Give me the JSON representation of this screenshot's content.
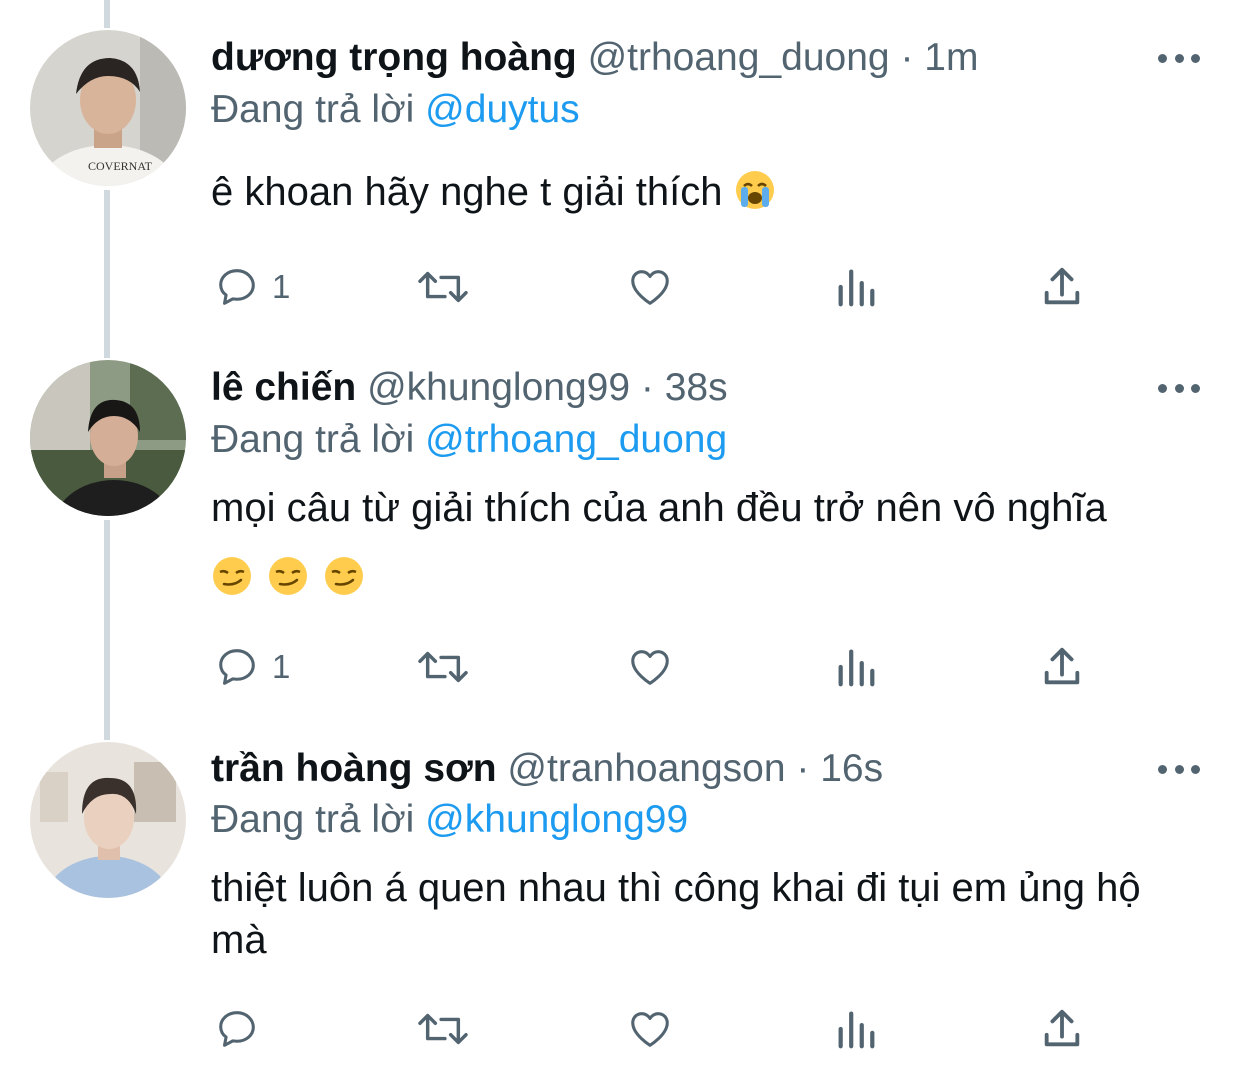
{
  "colors": {
    "mention": "#1d9bf0",
    "secondary_text": "#536471",
    "primary_text": "#0f1419",
    "thread_line": "#cfd9de"
  },
  "icons": {
    "reply": "speech-bubble-icon",
    "retweet": "retweet-icon",
    "like": "heart-icon",
    "views": "bar-chart-icon",
    "share": "share-upload-icon",
    "more": "more-dots-icon"
  },
  "tweets": [
    {
      "name": "dương trọng hoàng",
      "handle": "@trhoang_duong",
      "separator": "·",
      "time": "1m",
      "replying_prefix": "Đang trả lời",
      "replying_to": "@duytus",
      "text": "ê khoan hãy nghe t giải thích",
      "emoji": "loudly-crying-face",
      "reply_count": "1"
    },
    {
      "name": "lê chiến",
      "handle": "@khunglong99",
      "separator": "·",
      "time": "38s",
      "replying_prefix": "Đang trả lời",
      "replying_to": "@trhoang_duong",
      "text": "mọi câu từ giải thích của anh đều trở nên vô nghĩa",
      "emoji": "smirking-face x3",
      "reply_count": "1"
    },
    {
      "name": "trần hoàng sơn",
      "handle": "@tranhoangson",
      "separator": "·",
      "time": "16s",
      "replying_prefix": "Đang trả lời",
      "replying_to": "@khunglong99",
      "text": "thiệt luôn á quen nhau thì công khai đi tụi em ủng hộ mà",
      "reply_count": ""
    }
  ]
}
